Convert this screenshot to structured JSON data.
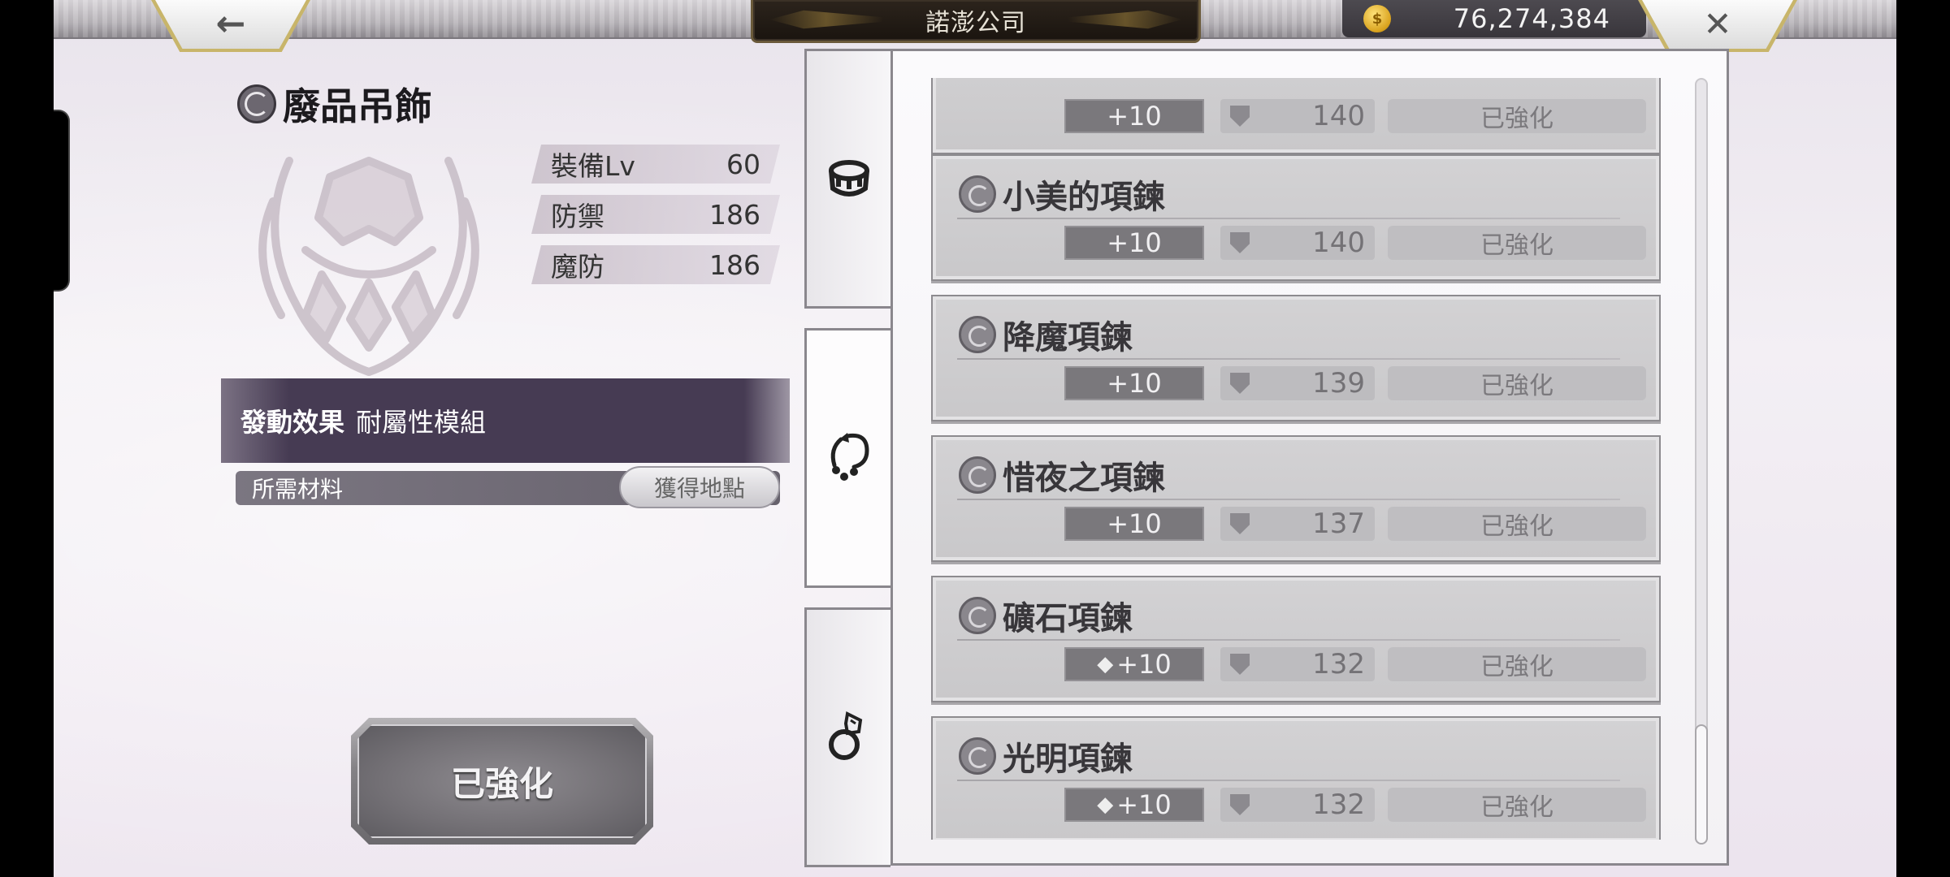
{
  "header": {
    "title": "諾澎公司",
    "back_icon": "←",
    "close_icon": "✕",
    "currency": {
      "icon": "coin-icon",
      "amount": "76,274,384"
    }
  },
  "item": {
    "name": "廢品吊飾",
    "stats": [
      {
        "label": "裝備Lv",
        "value": "60"
      },
      {
        "label": "防禦",
        "value": "186"
      },
      {
        "label": "魔防",
        "value": "186"
      }
    ],
    "effect_label": "發動效果",
    "effect_value": "耐屬性模組",
    "materials_label": "所需材料",
    "source_button": "獲得地點",
    "action_button": "已強化"
  },
  "tabs": [
    {
      "name": "bracelet",
      "icon": "bracelet-icon"
    },
    {
      "name": "necklace",
      "icon": "necklace-icon",
      "active": true
    },
    {
      "name": "ring",
      "icon": "ring-icon"
    }
  ],
  "list": [
    {
      "name": "",
      "level": "+10",
      "defense": "140",
      "status": "已強化",
      "gem": false
    },
    {
      "name": "小美的項鍊",
      "level": "+10",
      "defense": "140",
      "status": "已強化",
      "gem": false
    },
    {
      "name": "降魔項鍊",
      "level": "+10",
      "defense": "139",
      "status": "已強化",
      "gem": false
    },
    {
      "name": "惜夜之項鍊",
      "level": "+10",
      "defense": "137",
      "status": "已強化",
      "gem": false
    },
    {
      "name": "礦石項鍊",
      "level": "+10",
      "defense": "132",
      "status": "已強化",
      "gem": true
    },
    {
      "name": "光明項鍊",
      "level": "+10",
      "defense": "132",
      "status": "已強化",
      "gem": true
    }
  ],
  "colors": {
    "effect_bar": "#463b53",
    "card_bg": "#cfcecf",
    "gold_trim": "#c8b56a",
    "coin": "#d9a21d"
  }
}
